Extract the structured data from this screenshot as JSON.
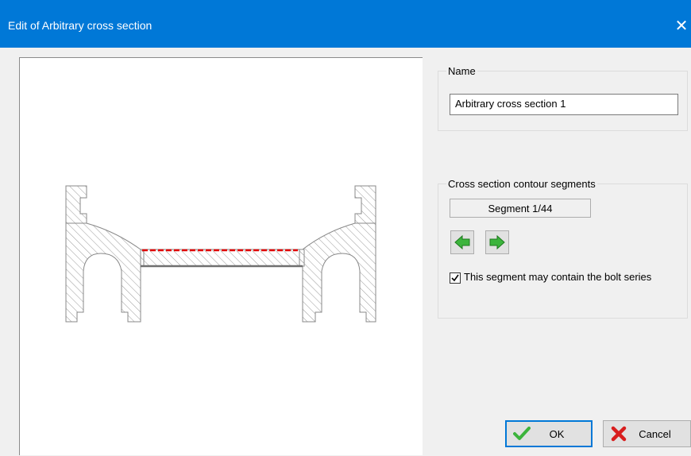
{
  "window": {
    "title": "Edit of Arbitrary cross section",
    "close_glyph": "✕"
  },
  "name_group": {
    "legend": "Name",
    "value": "Arbitrary cross section 1"
  },
  "segments_group": {
    "legend": "Cross section contour segments",
    "indicator": "Segment 1/44",
    "prev_icon": "arrow-left-icon",
    "next_icon": "arrow-right-icon",
    "bolt_checkbox_checked": true,
    "bolt_checkbox_label": "This segment may contain the bolt series"
  },
  "buttons": {
    "ok_label": "OK",
    "cancel_label": "Cancel"
  },
  "colors": {
    "titlebar": "#0078d7",
    "selected_segment": "#e00000",
    "arrow_green": "#3cb43c"
  }
}
